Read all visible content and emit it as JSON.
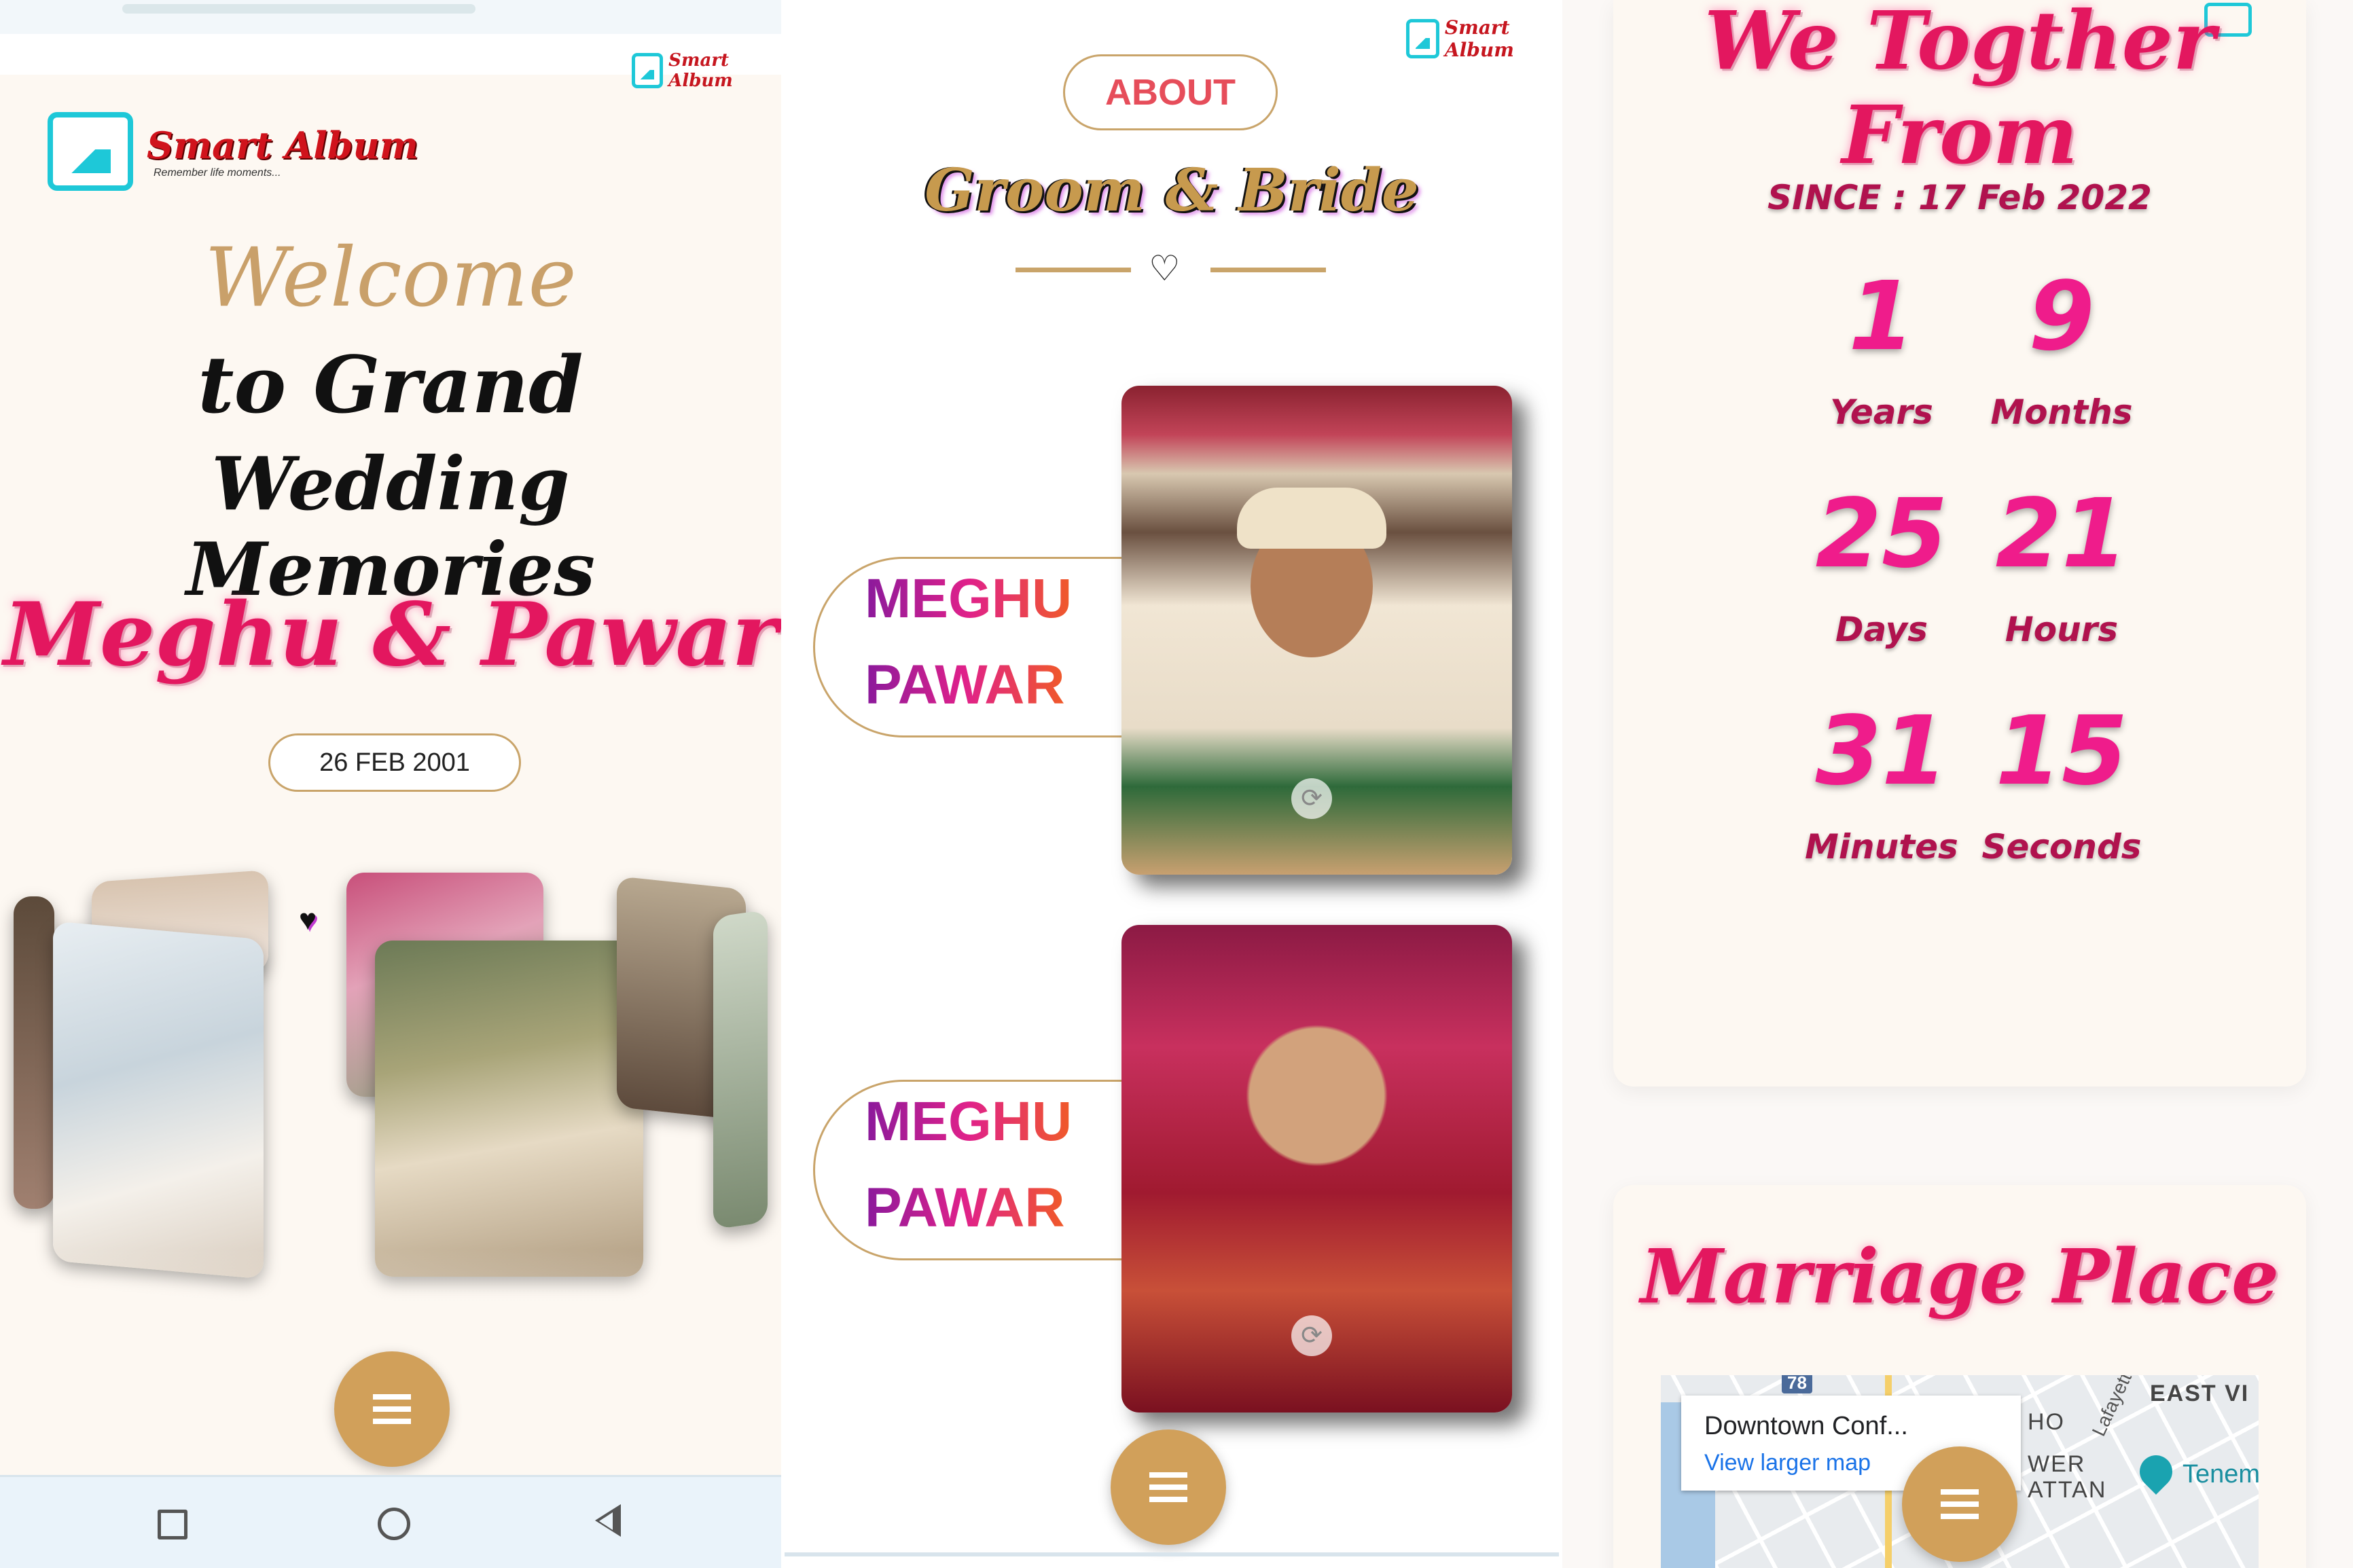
{
  "panel1": {
    "watermark_logo": "Smart Album",
    "logo": {
      "name": "Smart Album",
      "tagline": "Remember life moments..."
    },
    "welcome": "Welcome",
    "line2": "to Grand",
    "line3": "Wedding Memories",
    "couple": "Meghu & Pawar",
    "date": "26 FEB 2001",
    "nav": {
      "square": "recent-apps",
      "circle": "home",
      "triangle": "back"
    }
  },
  "panel2": {
    "watermark_logo": "Smart Album",
    "about_label": "ABOUT",
    "section_title": "Groom & Bride",
    "groom": {
      "first": "MEGHU",
      "last": "PAWAR"
    },
    "bride": {
      "first": "MEGHU",
      "last": "PAWAR"
    }
  },
  "panel3": {
    "title": "We Togther From",
    "since": "SINCE : 17 Feb 2022",
    "counter": [
      {
        "value": "1",
        "label": "Years"
      },
      {
        "value": "9",
        "label": "Months"
      },
      {
        "value": "25",
        "label": "Days"
      },
      {
        "value": "21",
        "label": "Hours"
      },
      {
        "value": "31",
        "label": "Minutes"
      },
      {
        "value": "15",
        "label": "Seconds"
      }
    ],
    "place_title": "Marriage Place",
    "map": {
      "place_name": "Downtown Conf...",
      "larger_map_link": "View larger map",
      "labels": [
        "EAST VI",
        "Lafayette",
        "HO",
        "WER",
        "ATTAN",
        "Tenem",
        "78"
      ]
    }
  },
  "colors": {
    "gold": "#d1a05a",
    "pink": "#e3175f",
    "teal": "#1ec8d8"
  }
}
